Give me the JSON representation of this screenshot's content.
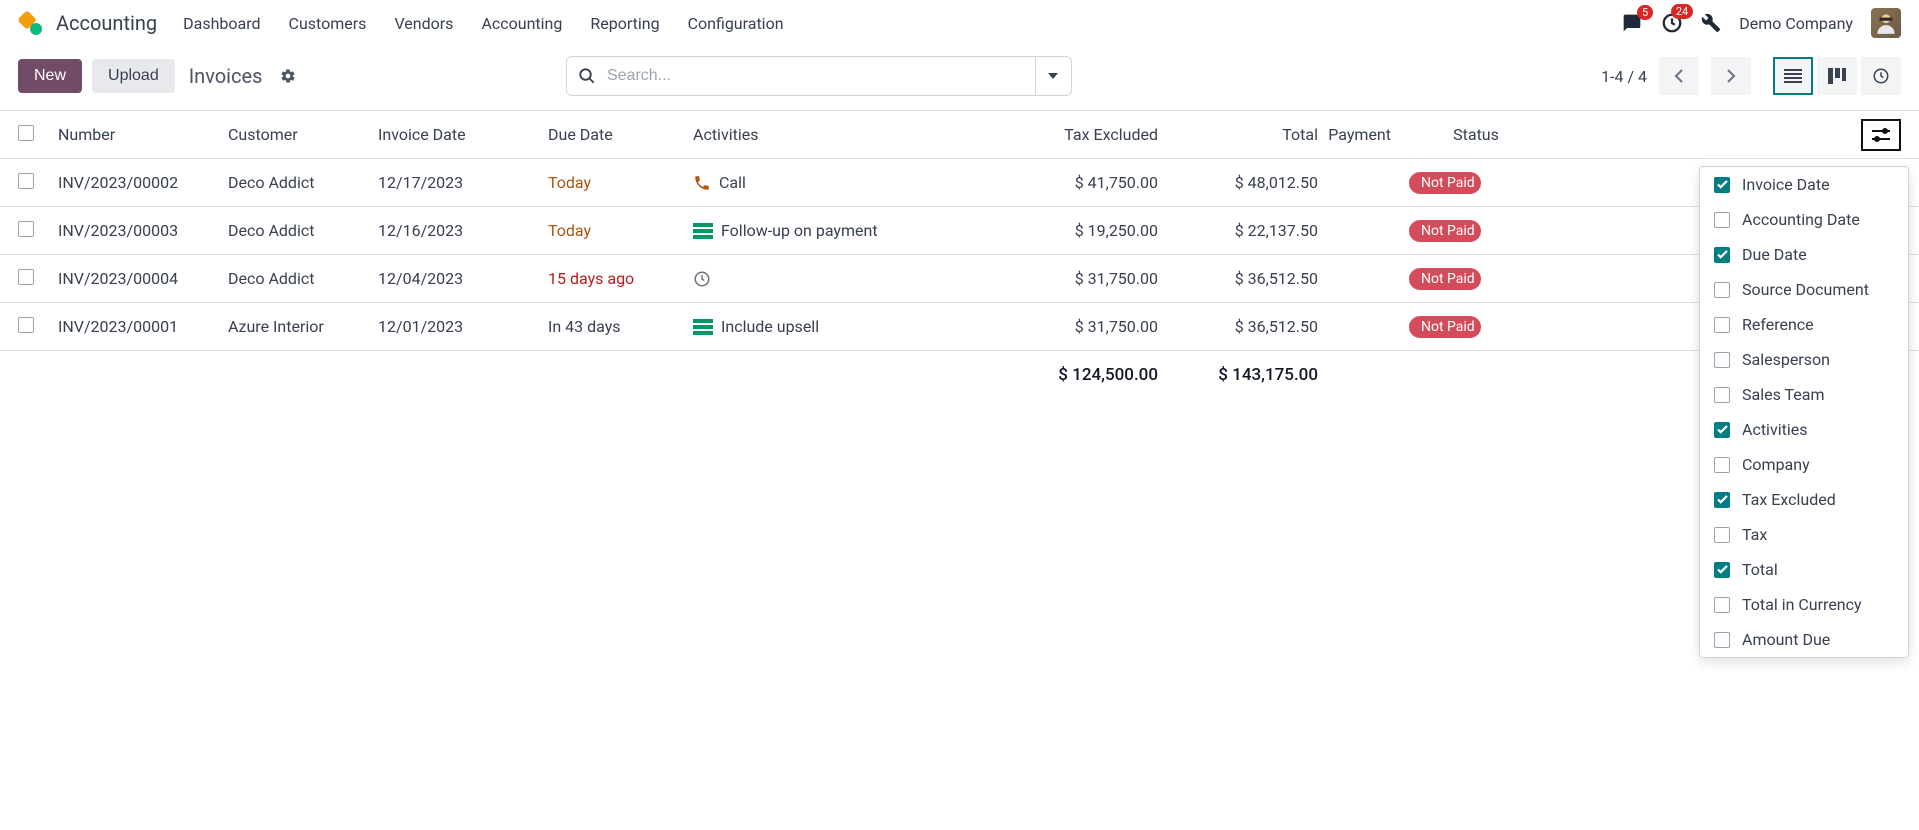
{
  "app_name": "Accounting",
  "menu": [
    "Dashboard",
    "Customers",
    "Vendors",
    "Accounting",
    "Reporting",
    "Configuration"
  ],
  "notif": {
    "messages": "5",
    "activities": "24"
  },
  "company": "Demo Company",
  "toolbar": {
    "new": "New",
    "upload": "Upload"
  },
  "breadcrumb": "Invoices",
  "search_placeholder": "Search...",
  "pager": "1-4 / 4",
  "columns": {
    "number": "Number",
    "customer": "Customer",
    "invoice_date": "Invoice Date",
    "due_date": "Due Date",
    "activities": "Activities",
    "tax_excluded": "Tax Excluded",
    "total": "Total",
    "payment": "Payment",
    "status": "Status"
  },
  "rows": [
    {
      "number": "INV/2023/00002",
      "customer": "Deco Addict",
      "invoice_date": "12/17/2023",
      "due_date": "Today",
      "due_class": "due-today",
      "activity_icon": "phone",
      "activity": "Call",
      "tax_excluded": "$ 41,750.00",
      "total": "$ 48,012.50",
      "status": "Not Paid"
    },
    {
      "number": "INV/2023/00003",
      "customer": "Deco Addict",
      "invoice_date": "12/16/2023",
      "due_date": "Today",
      "due_class": "due-today",
      "activity_icon": "list-green",
      "activity": "Follow-up on payment",
      "tax_excluded": "$ 19,250.00",
      "total": "$ 22,137.50",
      "status": "Not Paid"
    },
    {
      "number": "INV/2023/00004",
      "customer": "Deco Addict",
      "invoice_date": "12/04/2023",
      "due_date": "15 days ago",
      "due_class": "due-past",
      "activity_icon": "clock",
      "activity": "",
      "tax_excluded": "$ 31,750.00",
      "total": "$ 36,512.50",
      "status": "Not Paid"
    },
    {
      "number": "INV/2023/00001",
      "customer": "Azure Interior",
      "invoice_date": "12/01/2023",
      "due_date": "In 43 days",
      "due_class": "",
      "activity_icon": "list-green",
      "activity": "Include upsell",
      "tax_excluded": "$ 31,750.00",
      "total": "$ 36,512.50",
      "status": "Not Paid"
    }
  ],
  "totals": {
    "tax_excluded": "$ 124,500.00",
    "total": "$ 143,175.00"
  },
  "optional_columns": [
    {
      "label": "Invoice Date",
      "checked": true
    },
    {
      "label": "Accounting Date",
      "checked": false
    },
    {
      "label": "Due Date",
      "checked": true
    },
    {
      "label": "Source Document",
      "checked": false
    },
    {
      "label": "Reference",
      "checked": false
    },
    {
      "label": "Salesperson",
      "checked": false
    },
    {
      "label": "Sales Team",
      "checked": false
    },
    {
      "label": "Activities",
      "checked": true
    },
    {
      "label": "Company",
      "checked": false
    },
    {
      "label": "Tax Excluded",
      "checked": true
    },
    {
      "label": "Tax",
      "checked": false
    },
    {
      "label": "Total",
      "checked": true
    },
    {
      "label": "Total in Currency",
      "checked": false
    },
    {
      "label": "Amount Due",
      "checked": false
    }
  ]
}
